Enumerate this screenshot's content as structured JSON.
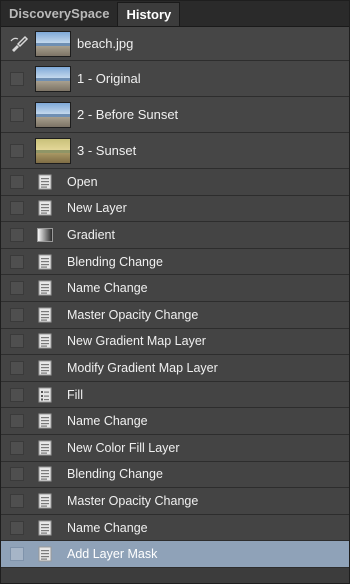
{
  "tabs": [
    {
      "label": "DiscoverySpace"
    },
    {
      "label": "History"
    }
  ],
  "snapshots": [
    {
      "label": "beach.jpg",
      "thumb": "beach-original"
    },
    {
      "label": "1 - Original",
      "thumb": "beach-original"
    },
    {
      "label": "2 - Before Sunset",
      "thumb": "beach-original"
    },
    {
      "label": "3 - Sunset",
      "thumb": "beach-sunset"
    }
  ],
  "steps": [
    {
      "label": "Open",
      "icon": "document-icon"
    },
    {
      "label": "New Layer",
      "icon": "document-icon"
    },
    {
      "label": "Gradient",
      "icon": "gradient-icon"
    },
    {
      "label": "Blending Change",
      "icon": "document-icon"
    },
    {
      "label": "Name Change",
      "icon": "document-icon"
    },
    {
      "label": "Master Opacity Change",
      "icon": "document-icon"
    },
    {
      "label": "New Gradient Map Layer",
      "icon": "document-icon"
    },
    {
      "label": "Modify Gradient Map Layer",
      "icon": "document-icon"
    },
    {
      "label": "Fill",
      "icon": "fill-list-icon"
    },
    {
      "label": "Name Change",
      "icon": "document-icon"
    },
    {
      "label": "New Color Fill Layer",
      "icon": "document-icon"
    },
    {
      "label": "Blending Change",
      "icon": "document-icon"
    },
    {
      "label": "Master Opacity Change",
      "icon": "document-icon"
    },
    {
      "label": "Name Change",
      "icon": "document-icon"
    },
    {
      "label": "Add Layer Mask",
      "icon": "document-icon",
      "selected": true
    }
  ],
  "colors": {
    "panel_bg": "#3c3c3c",
    "row_bg": "#444444",
    "selected_row": "#8fa2b8",
    "text": "#f0f0f0"
  }
}
